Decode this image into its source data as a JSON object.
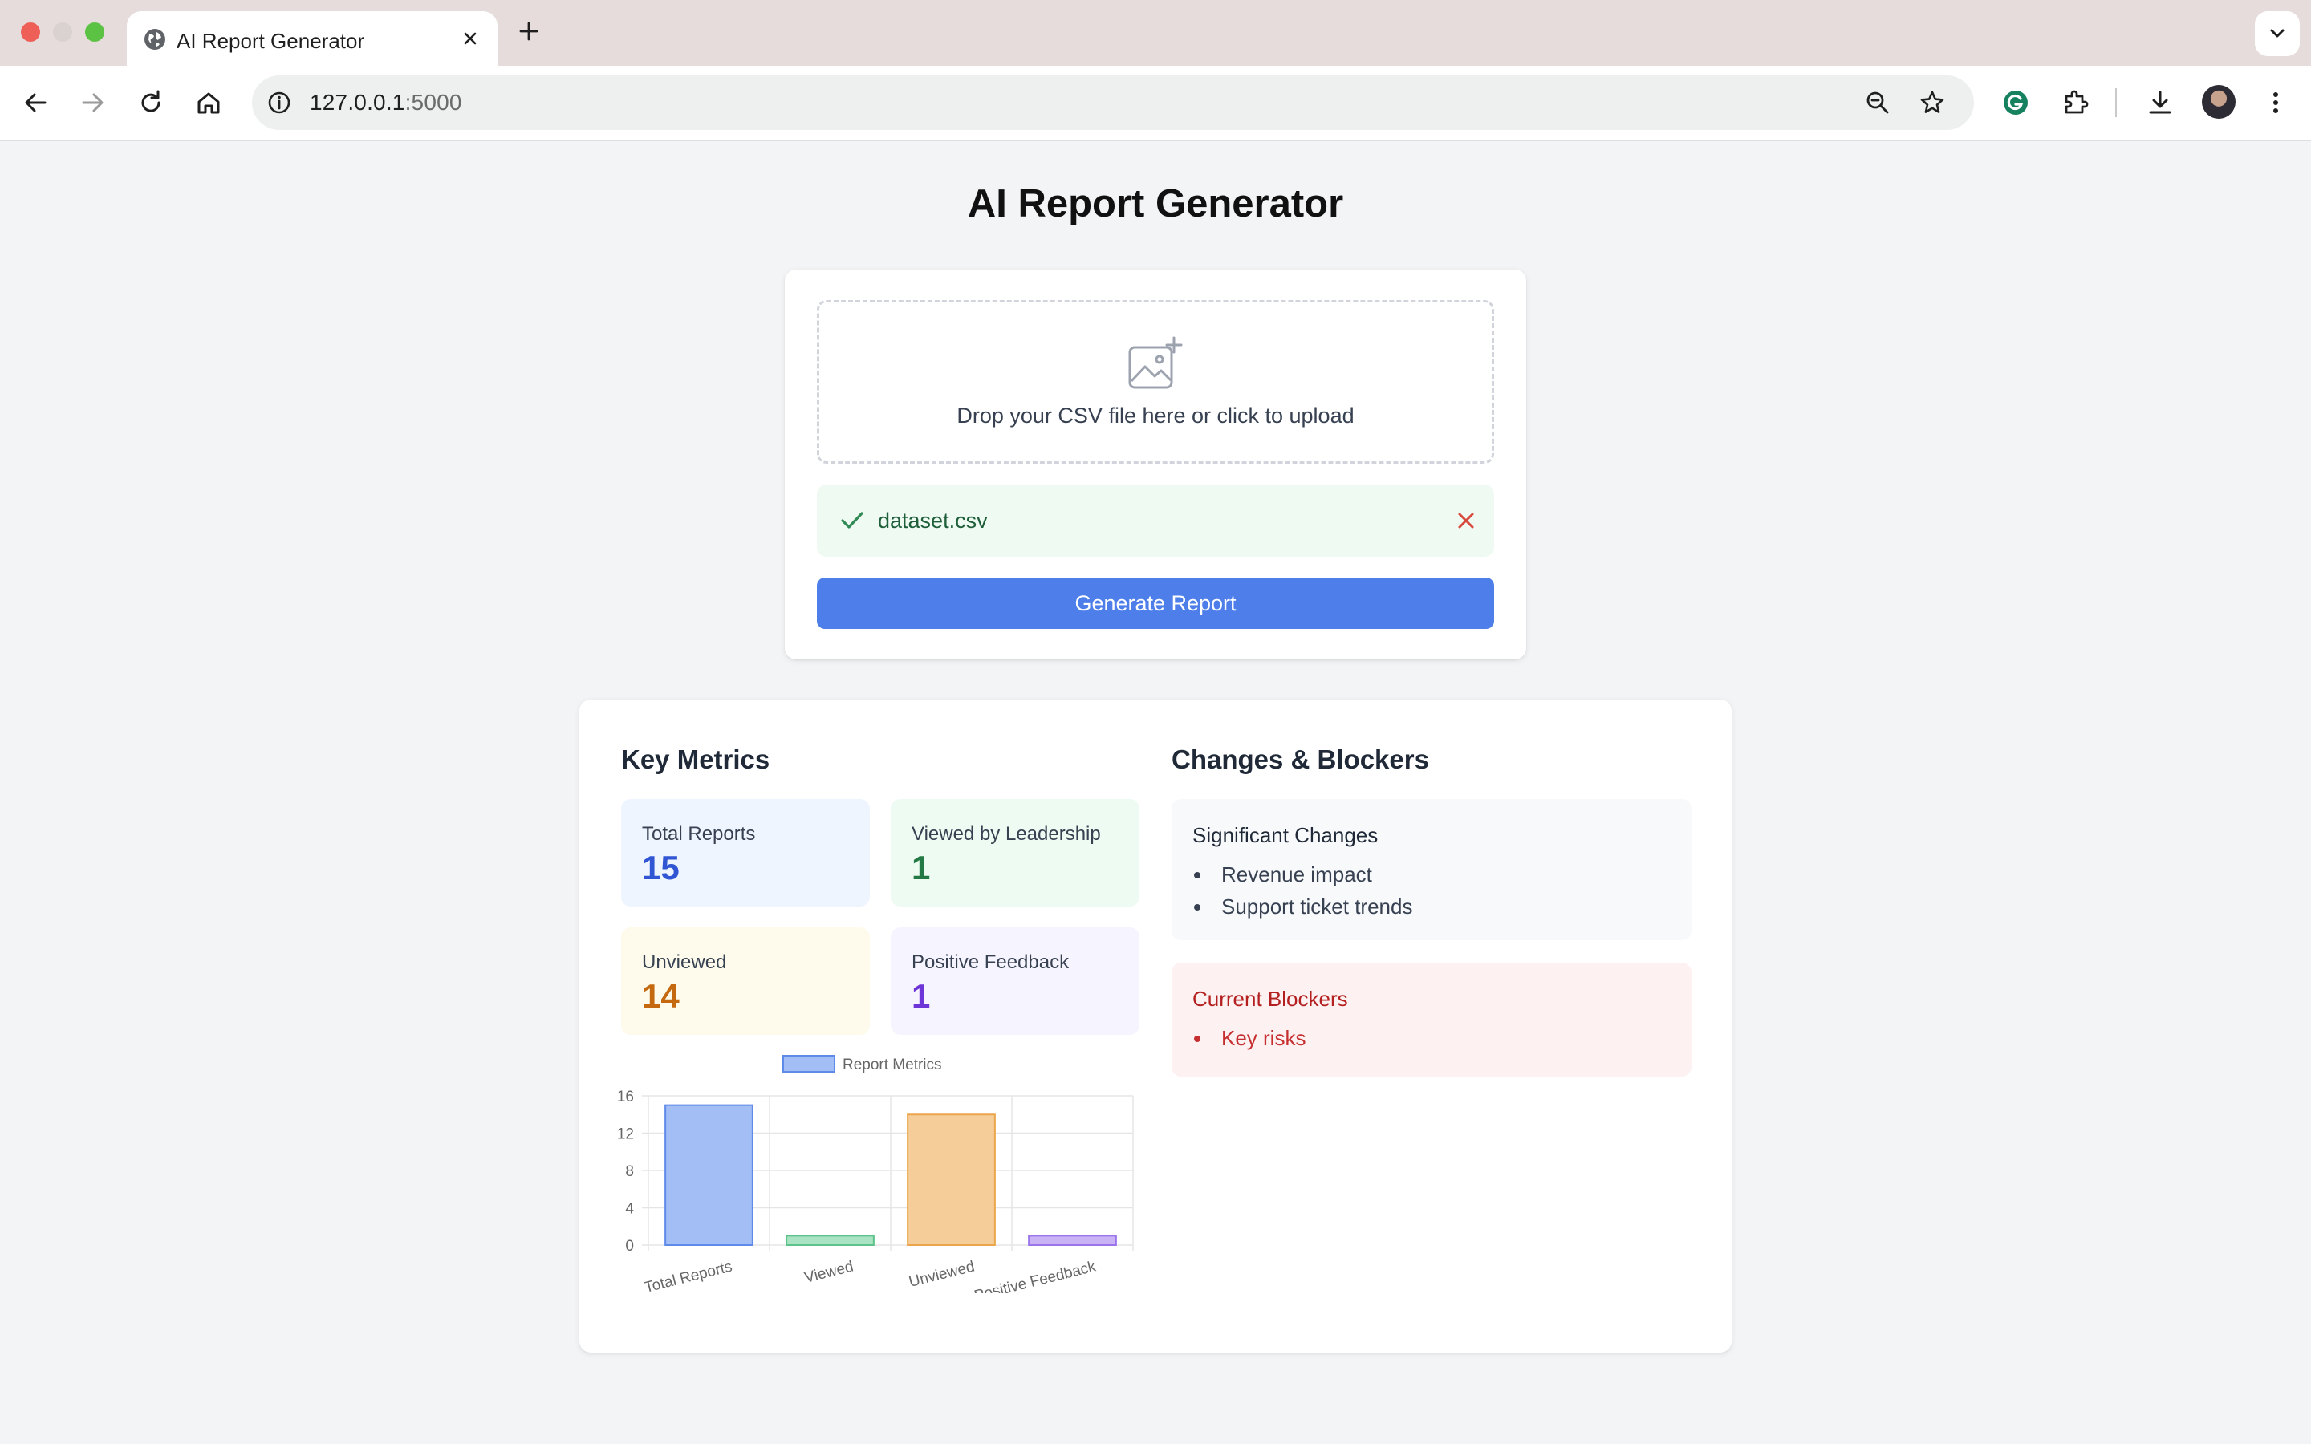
{
  "browser": {
    "tab_title": "AI Report Generator",
    "url_host": "127.0.0.1",
    "url_port": ":5000"
  },
  "page": {
    "title": "AI Report Generator"
  },
  "upload": {
    "dropzone_text": "Drop your CSV file here or click to upload",
    "file_name": "dataset.csv",
    "generate_label": "Generate Report"
  },
  "metrics": {
    "heading": "Key Metrics",
    "cards": [
      {
        "label": "Total Reports",
        "value": "15",
        "color": "#3156d3",
        "bg": "#eff5ff"
      },
      {
        "label": "Viewed by Leadership",
        "value": "1",
        "color": "#237a45",
        "bg": "#eefbf3"
      },
      {
        "label": "Unviewed",
        "value": "14",
        "color": "#c4690f",
        "bg": "#fefbec"
      },
      {
        "label": "Positive Feedback",
        "value": "1",
        "color": "#6d35d8",
        "bg": "#f6f4ff"
      }
    ]
  },
  "changes": {
    "heading": "Changes & Blockers",
    "significant": {
      "title": "Significant Changes",
      "items": [
        "Revenue impact",
        "Support ticket trends"
      ]
    },
    "blockers": {
      "title": "Current Blockers",
      "items": [
        "Key risks"
      ]
    }
  },
  "chart_data": {
    "type": "bar",
    "categories": [
      "Total Reports",
      "Viewed",
      "Unviewed",
      "Positive Feedback"
    ],
    "series": [
      {
        "name": "Report Metrics",
        "values": [
          15,
          1,
          14,
          1
        ]
      }
    ],
    "ylim": [
      0,
      16
    ],
    "yticks": [
      0,
      4,
      8,
      12,
      16
    ],
    "legend": "top-center",
    "grid": true,
    "colors": {
      "fill": [
        "#a3bdf5",
        "#a9e3c3",
        "#f5cd98",
        "#cab3f5"
      ],
      "stroke": [
        "#5f8ae9",
        "#5cc48a",
        "#eba54a",
        "#9b74ec"
      ],
      "legend_fill": "#a3bdf5",
      "legend_stroke": "#5f8ae9"
    }
  }
}
